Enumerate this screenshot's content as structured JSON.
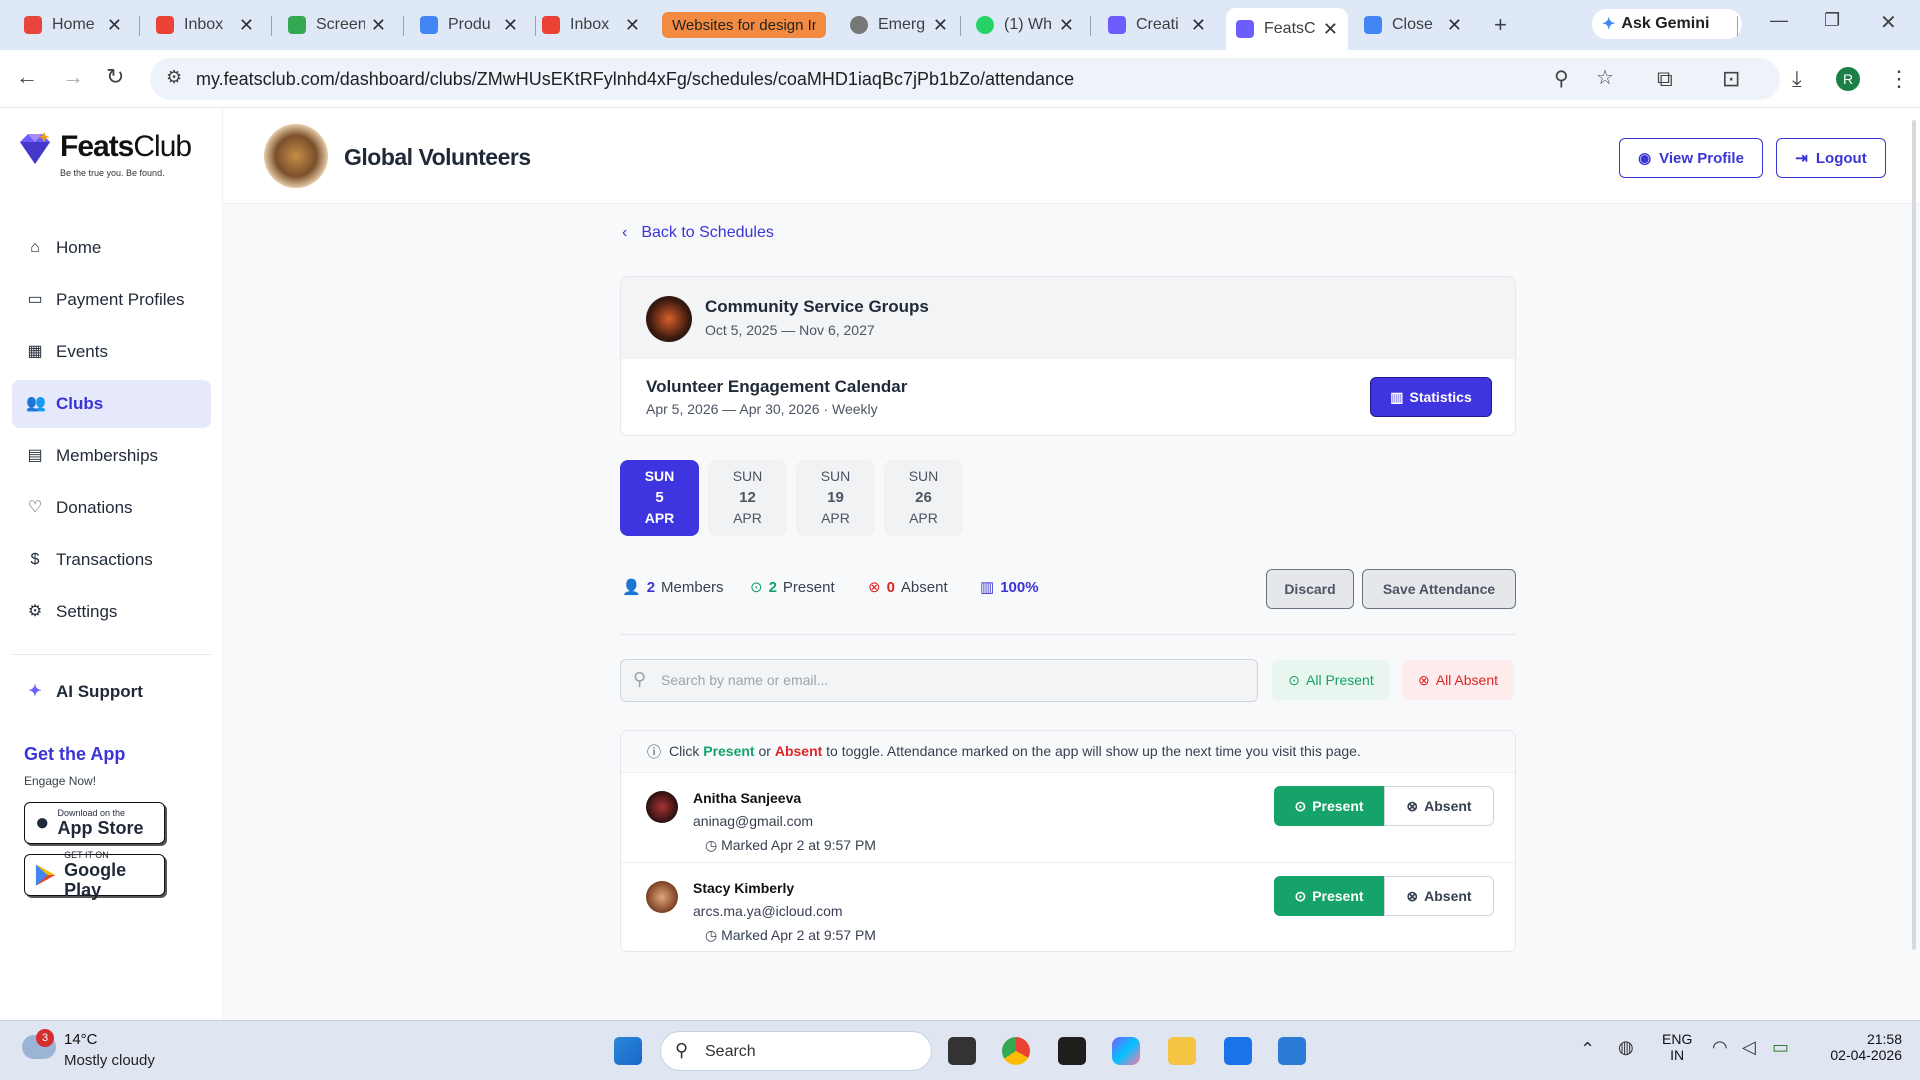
{
  "browser": {
    "tabs": [
      {
        "title": "Home",
        "color": "#e8453c"
      },
      {
        "title": "Inbox",
        "color": "#ea4335"
      },
      {
        "title": "Screen",
        "color": "#34a853"
      },
      {
        "title": "Produ",
        "color": "#4285f4"
      },
      {
        "title": "Inbox",
        "color": "#ea4335"
      },
      {
        "title": "Websites for design In",
        "color": "#f28b41"
      },
      {
        "title": "Emerg",
        "color": "#555555"
      },
      {
        "title": "(1) Wh",
        "color": "#25d366"
      },
      {
        "title": "Creati",
        "color": "#6d5dfc"
      },
      {
        "title": "FeatsC",
        "color": "#6d5dfc"
      },
      {
        "title": "Close",
        "color": "#4285f4"
      }
    ],
    "gemini_label": "Ask Gemini",
    "url": "my.featsclub.com/dashboard/clubs/ZMwHUsEKtRFylnhd4xFg/schedules/coaMHD1iaqBc7jPb1bZo/attendance",
    "profile_initial": "R"
  },
  "sidebar": {
    "brand_bold": "Feats",
    "brand_light": "Club",
    "tagline": "Be the true you. Be found.",
    "items": [
      {
        "label": "Home",
        "icon": "home-icon"
      },
      {
        "label": "Payment Profiles",
        "icon": "wallet-icon"
      },
      {
        "label": "Events",
        "icon": "calendar-icon"
      },
      {
        "label": "Clubs",
        "icon": "users-icon"
      },
      {
        "label": "Memberships",
        "icon": "card-icon"
      },
      {
        "label": "Donations",
        "icon": "heart-icon"
      },
      {
        "label": "Transactions",
        "icon": "dollar-icon"
      },
      {
        "label": "Settings",
        "icon": "gear-icon"
      }
    ],
    "ai_support": "AI Support",
    "get_app_title": "Get the App",
    "get_app_sub": "Engage Now!",
    "app_store_small": "Download on the",
    "app_store_big": "App Store",
    "play_small": "GET IT ON",
    "play_big": "Google Play"
  },
  "header": {
    "club_name": "Global Volunteers",
    "view_profile": "View Profile",
    "logout": "Logout"
  },
  "main": {
    "back_label": "Back to Schedules",
    "group_title": "Community Service Groups",
    "group_dates": "Oct 5, 2025 — Nov 6, 2027",
    "schedule_title": "Volunteer Engagement Calendar",
    "schedule_meta": "Apr 5, 2026 — Apr 30, 2026 · Weekly",
    "statistics_label": "Statistics",
    "dates": [
      {
        "dow": "SUN",
        "day": "5",
        "month": "APR"
      },
      {
        "dow": "SUN",
        "day": "12",
        "month": "APR"
      },
      {
        "dow": "SUN",
        "day": "19",
        "month": "APR"
      },
      {
        "dow": "SUN",
        "day": "26",
        "month": "APR"
      }
    ],
    "stats": {
      "members_count": "2",
      "members_label": "Members",
      "present_count": "2",
      "present_label": "Present",
      "absent_count": "0",
      "absent_label": "Absent",
      "rate": "100%"
    },
    "discard_label": "Discard",
    "save_label": "Save Attendance",
    "search_placeholder": "Search by name or email...",
    "all_present_label": "All Present",
    "all_absent_label": "All Absent",
    "hint_click": "Click",
    "hint_present": "Present",
    "hint_or": "or",
    "hint_absent": "Absent",
    "hint_rest": "to toggle. Attendance marked on the app will show up the next time you visit this page.",
    "members": [
      {
        "name": "Anitha Sanjeeva",
        "email": "aninag@gmail.com",
        "marked": "Marked Apr 2 at 9:57 PM"
      },
      {
        "name": "Stacy Kimberly",
        "email": "arcs.ma.ya@icloud.com",
        "marked": "Marked Apr 2 at 9:57 PM"
      }
    ],
    "present_btn": "Present",
    "absent_btn": "Absent"
  },
  "taskbar": {
    "weather_temp": "14°C",
    "weather_desc": "Mostly cloudy",
    "weather_badge": "3",
    "search_label": "Search",
    "lang_top": "ENG",
    "lang_bottom": "IN",
    "time": "21:58",
    "date": "02-04-2026"
  },
  "colors": {
    "accent": "#3f35e0",
    "present": "#16a36a",
    "absent": "#dc2626"
  }
}
